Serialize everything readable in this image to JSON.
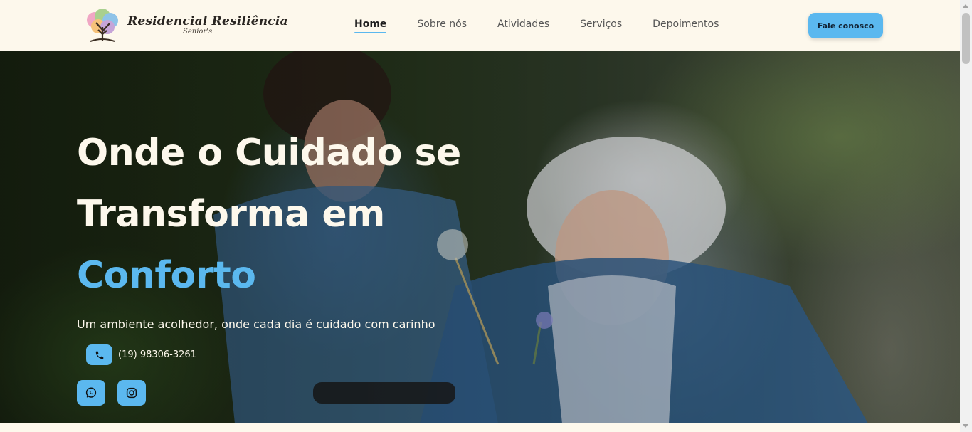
{
  "header": {
    "logo_title": "Residencial Resiliência",
    "logo_subtitle": "Senior's",
    "nav": [
      {
        "label": "Home",
        "active": true
      },
      {
        "label": "Sobre nós",
        "active": false
      },
      {
        "label": "Atividades",
        "active": false
      },
      {
        "label": "Serviços",
        "active": false
      },
      {
        "label": "Depoimentos",
        "active": false
      }
    ],
    "cta_label": "Fale conosco"
  },
  "hero": {
    "headline_line1": "Onde o Cuidado se",
    "headline_line2": "Transforma em",
    "headline_accent": "Conforto",
    "subtitle": "Um ambiente acolhedor, onde cada dia é cuidado com carinho",
    "phone": "(19) 98306-3261",
    "icons": {
      "phone": "phone-icon",
      "whatsapp": "whatsapp-icon",
      "instagram": "instagram-icon"
    }
  },
  "colors": {
    "accent": "#5bb8ef",
    "background": "#fdf8ec",
    "text_dark": "#1e1e1e"
  }
}
